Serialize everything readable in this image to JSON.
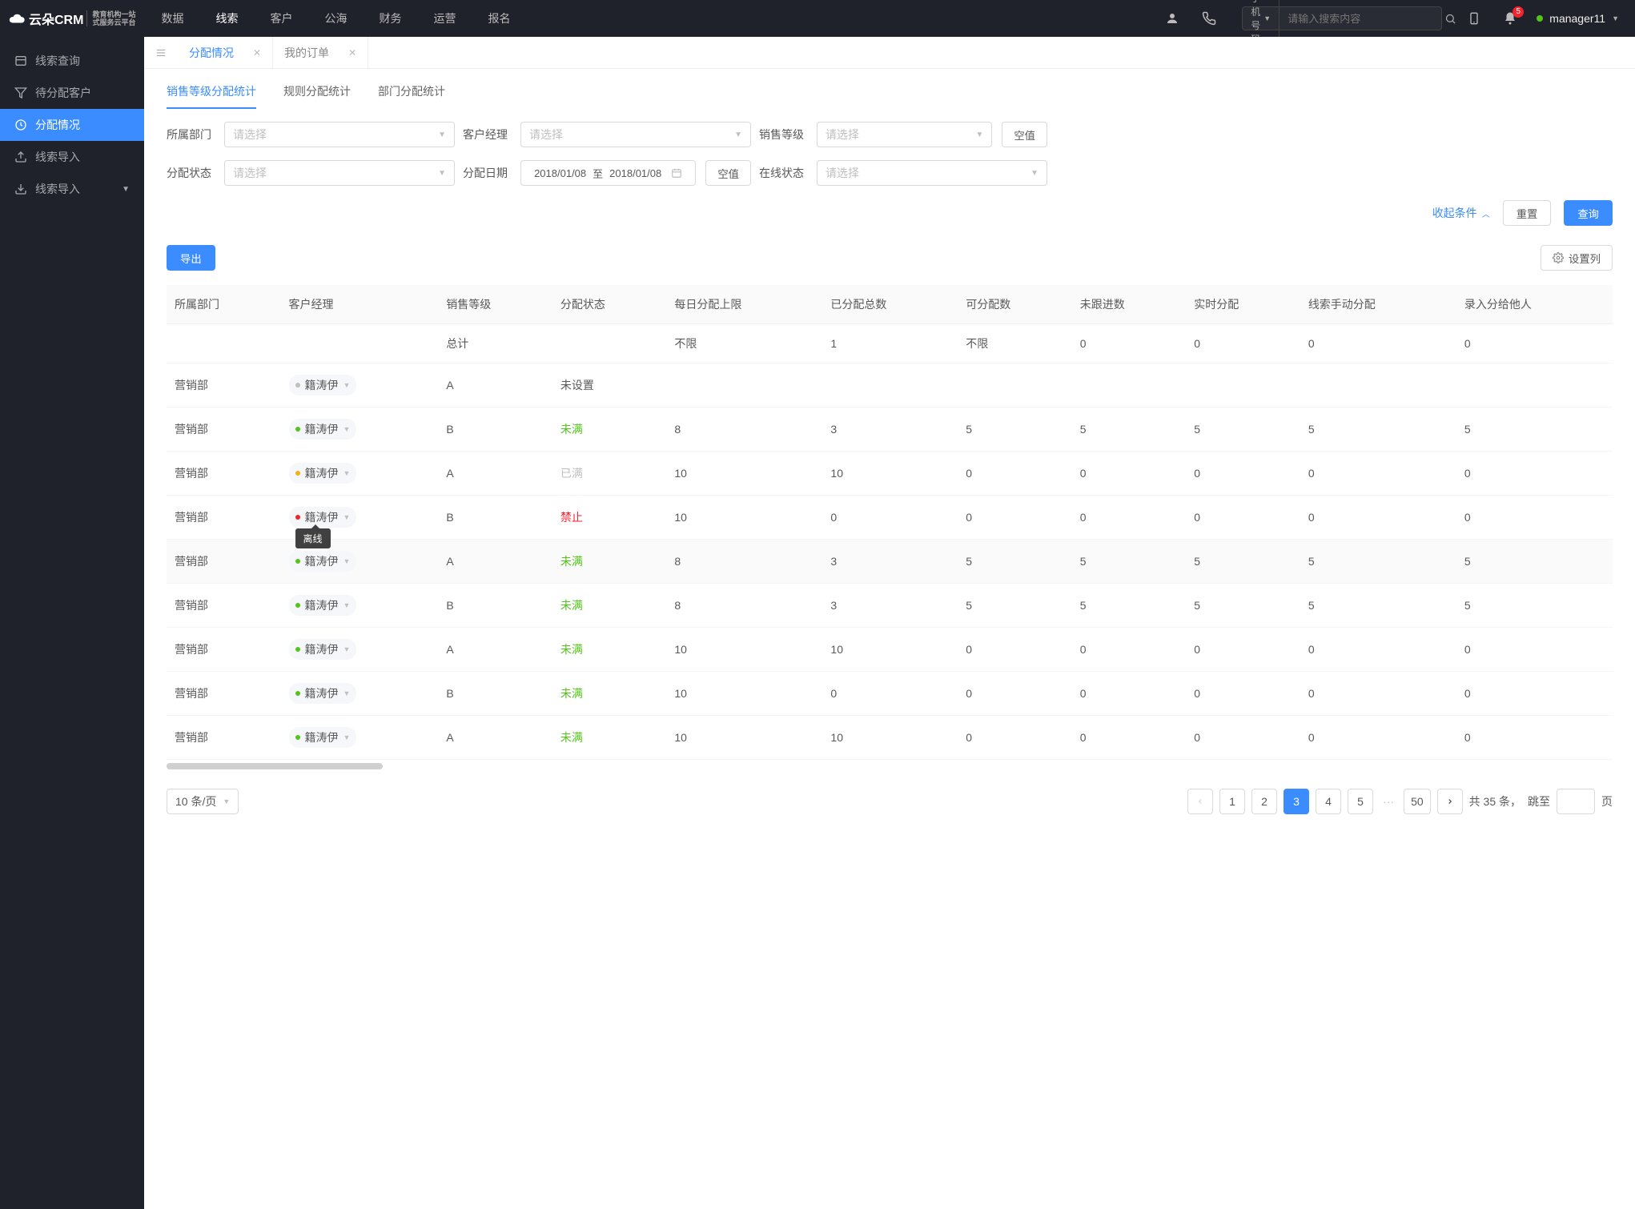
{
  "logo": {
    "brand": "云朵CRM",
    "sub1": "教育机构一站",
    "sub2": "式服务云平台"
  },
  "top_menu": {
    "items": [
      "数据",
      "线索",
      "客户",
      "公海",
      "财务",
      "运营",
      "报名"
    ],
    "active_index": 1
  },
  "search": {
    "prefix": "手机号码",
    "placeholder": "请输入搜索内容"
  },
  "notif": {
    "count": "5"
  },
  "user": {
    "name": "manager11"
  },
  "sidebar": {
    "items": [
      {
        "label": "线索查询"
      },
      {
        "label": "待分配客户"
      },
      {
        "label": "分配情况"
      },
      {
        "label": "线索导入"
      },
      {
        "label": "线索导入",
        "expandable": true
      }
    ],
    "active_index": 2
  },
  "tabs": {
    "items": [
      "分配情况",
      "我的订单"
    ],
    "active_index": 0
  },
  "sub_tabs": {
    "items": [
      "销售等级分配统计",
      "规则分配统计",
      "部门分配统计"
    ],
    "active_index": 0
  },
  "filters": {
    "f1": {
      "label": "所属部门",
      "placeholder": "请选择"
    },
    "f2": {
      "label": "客户经理",
      "placeholder": "请选择"
    },
    "f3": {
      "label": "销售等级",
      "placeholder": "请选择",
      "extra_btn": "空值"
    },
    "f4": {
      "label": "分配状态",
      "placeholder": "请选择"
    },
    "f5": {
      "label": "分配日期",
      "from": "2018/01/08",
      "sep": "至",
      "to": "2018/01/08",
      "extra_btn": "空值"
    },
    "f6": {
      "label": "在线状态",
      "placeholder": "请选择"
    }
  },
  "actions": {
    "collapse": "收起条件",
    "reset": "重置",
    "query": "查询"
  },
  "toolbar": {
    "export": "导出",
    "columns": "设置列"
  },
  "table": {
    "columns": [
      "所属部门",
      "客户经理",
      "销售等级",
      "分配状态",
      "每日分配上限",
      "已分配总数",
      "可分配数",
      "未跟进数",
      "实时分配",
      "线索手动分配",
      "录入分给他人"
    ],
    "summary": {
      "level": "总计",
      "daily": "不限",
      "assigned": "1",
      "available": "不限",
      "nofollow": "0",
      "realtime": "0",
      "manual": "0",
      "input": "0"
    },
    "manager_name": "籍涛伊",
    "tooltip": "离线",
    "rows": [
      {
        "dept": "营销部",
        "dot": "gray",
        "level": "A",
        "status": "未设置",
        "status_cls": "",
        "d": "",
        "a": "",
        "av": "",
        "nf": "",
        "rt": "",
        "m": "",
        "inp": ""
      },
      {
        "dept": "营销部",
        "dot": "green",
        "level": "B",
        "status": "未满",
        "status_cls": "status-green",
        "d": "8",
        "a": "3",
        "av": "5",
        "nf": "5",
        "rt": "5",
        "m": "5",
        "inp": "5"
      },
      {
        "dept": "营销部",
        "dot": "yellow",
        "level": "A",
        "status": "已满",
        "status_cls": "status-gray",
        "d": "10",
        "a": "10",
        "av": "0",
        "nf": "0",
        "rt": "0",
        "m": "0",
        "inp": "0"
      },
      {
        "dept": "营销部",
        "dot": "red",
        "level": "B",
        "status": "禁止",
        "status_cls": "status-red",
        "d": "10",
        "a": "0",
        "av": "0",
        "nf": "0",
        "rt": "0",
        "m": "0",
        "inp": "0",
        "tooltip": true
      },
      {
        "dept": "营销部",
        "dot": "green",
        "level": "A",
        "status": "未满",
        "status_cls": "status-green",
        "d": "8",
        "a": "3",
        "av": "5",
        "nf": "5",
        "rt": "5",
        "m": "5",
        "inp": "5",
        "hl": true
      },
      {
        "dept": "营销部",
        "dot": "green",
        "level": "B",
        "status": "未满",
        "status_cls": "status-green",
        "d": "8",
        "a": "3",
        "av": "5",
        "nf": "5",
        "rt": "5",
        "m": "5",
        "inp": "5"
      },
      {
        "dept": "营销部",
        "dot": "green",
        "level": "A",
        "status": "未满",
        "status_cls": "status-green",
        "d": "10",
        "a": "10",
        "av": "0",
        "nf": "0",
        "rt": "0",
        "m": "0",
        "inp": "0"
      },
      {
        "dept": "营销部",
        "dot": "green",
        "level": "B",
        "status": "未满",
        "status_cls": "status-green",
        "d": "10",
        "a": "0",
        "av": "0",
        "nf": "0",
        "rt": "0",
        "m": "0",
        "inp": "0"
      },
      {
        "dept": "营销部",
        "dot": "green",
        "level": "A",
        "status": "未满",
        "status_cls": "status-green",
        "d": "10",
        "a": "10",
        "av": "0",
        "nf": "0",
        "rt": "0",
        "m": "0",
        "inp": "0"
      }
    ]
  },
  "pagination": {
    "size_label": "10 条/页",
    "pages": [
      "1",
      "2",
      "3",
      "4",
      "5"
    ],
    "ellipsis": "···",
    "last": "50",
    "active_index": 2,
    "total_label": "共 35 条，",
    "jump_prefix": "跳至",
    "jump_suffix": "页"
  }
}
